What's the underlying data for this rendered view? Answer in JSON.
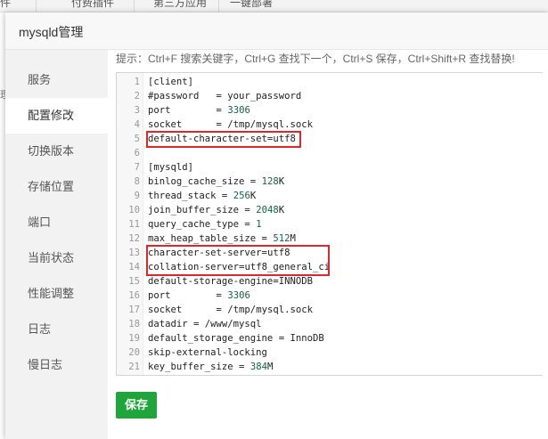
{
  "background": {
    "tabs": [
      "件",
      "付费插件",
      "第三方应用",
      "一键部署"
    ],
    "left_cut_text": "理"
  },
  "modal": {
    "title": "mysqld管理"
  },
  "sidebar": {
    "items": [
      {
        "label": "服务"
      },
      {
        "label": "配置修改"
      },
      {
        "label": "切换版本"
      },
      {
        "label": "存储位置"
      },
      {
        "label": "端口"
      },
      {
        "label": "当前状态"
      },
      {
        "label": "性能调整"
      },
      {
        "label": "日志"
      },
      {
        "label": "慢日志"
      }
    ],
    "active_index": 1
  },
  "hint": "提示：Ctrl+F 搜索关键字，Ctrl+G 查找下一个，Ctrl+S 保存，Ctrl+Shift+R 查找替换!",
  "editor": {
    "lines": [
      {
        "n": "1",
        "text": "[client]"
      },
      {
        "n": "2",
        "text": "#password   = your_password"
      },
      {
        "n": "3",
        "text": "port        = 3306"
      },
      {
        "n": "4",
        "text": "socket      = /tmp/mysql.sock"
      },
      {
        "n": "5",
        "text": "default-character-set=utf8"
      },
      {
        "n": "6",
        "text": ""
      },
      {
        "n": "7",
        "text": "[mysqld]"
      },
      {
        "n": "8",
        "text": "binlog_cache_size = 128K"
      },
      {
        "n": "9",
        "text": "thread_stack = 256K"
      },
      {
        "n": "10",
        "text": "join_buffer_size = 2048K"
      },
      {
        "n": "11",
        "text": "query_cache_type = 1"
      },
      {
        "n": "12",
        "text": "max_heap_table_size = 512M"
      },
      {
        "n": "13",
        "text": "character-set-server=utf8"
      },
      {
        "n": "14",
        "text": "collation-server=utf8_general_ci"
      },
      {
        "n": "15",
        "text": "default-storage-engine=INNODB"
      },
      {
        "n": "16",
        "text": "port        = 3306"
      },
      {
        "n": "17",
        "text": "socket      = /tmp/mysql.sock"
      },
      {
        "n": "18",
        "text": "datadir = /www/mysql"
      },
      {
        "n": "19",
        "text": "default_storage_engine = InnoDB"
      },
      {
        "n": "20",
        "text": "skip-external-locking"
      },
      {
        "n": "21",
        "text": "key_buffer_size = 384M"
      }
    ],
    "highlighted_lines": [
      [
        5
      ],
      [
        13,
        14
      ]
    ],
    "highlight_color": "#e0262b",
    "number_color": "#116644"
  },
  "save_button": {
    "label": "保存",
    "color": "#20a53a"
  }
}
